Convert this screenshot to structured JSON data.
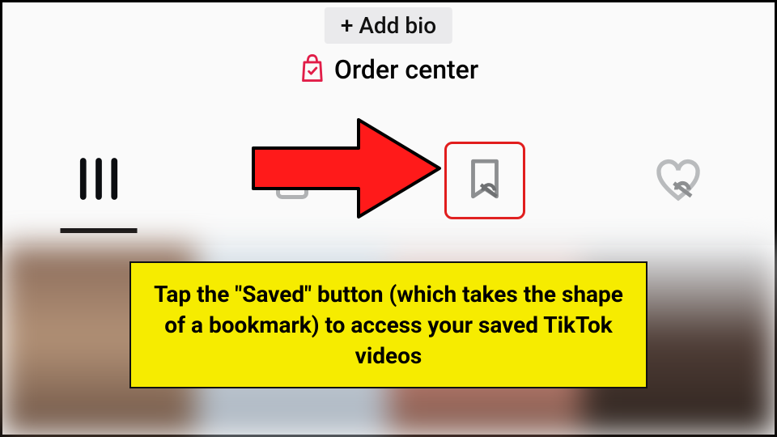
{
  "profile": {
    "add_bio_label": "+ Add bio",
    "order_center_label": "Order center"
  },
  "tabs": {
    "posts_name": "posts-tab",
    "private_name": "private-tab",
    "saved_name": "saved-tab",
    "liked_name": "liked-tab"
  },
  "annotation": {
    "caption": "Tap the \"Saved\" button (which takes the shape of a bookmark) to access your saved TikTok videos"
  },
  "colors": {
    "highlight": "#e11d1d",
    "caption_bg": "#f6ec00",
    "arrow": "#ff1a1a"
  }
}
